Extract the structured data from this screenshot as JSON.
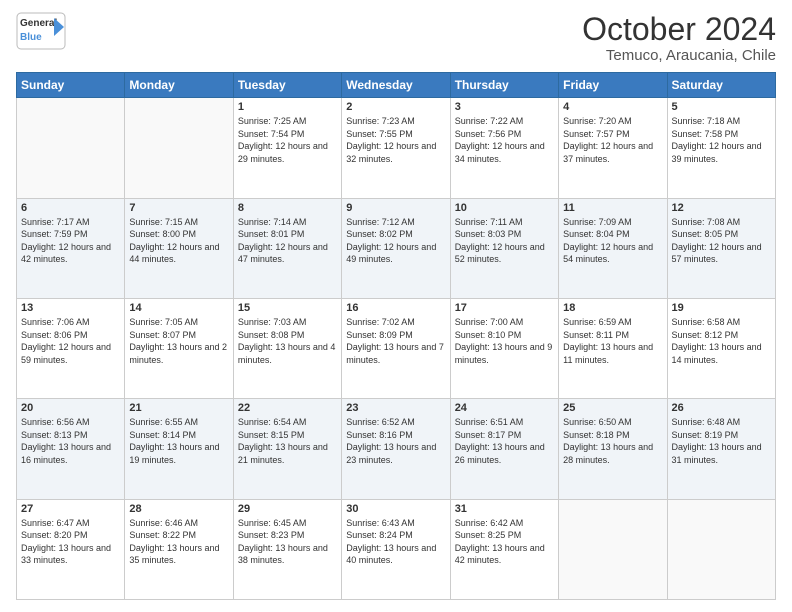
{
  "logo": {
    "line1": "General",
    "line2": "Blue"
  },
  "title": "October 2024",
  "subtitle": "Temuco, Araucania, Chile",
  "days_of_week": [
    "Sunday",
    "Monday",
    "Tuesday",
    "Wednesday",
    "Thursday",
    "Friday",
    "Saturday"
  ],
  "weeks": [
    [
      {
        "day": "",
        "sunrise": "",
        "sunset": "",
        "daylight": ""
      },
      {
        "day": "",
        "sunrise": "",
        "sunset": "",
        "daylight": ""
      },
      {
        "day": "1",
        "sunrise": "Sunrise: 7:25 AM",
        "sunset": "Sunset: 7:54 PM",
        "daylight": "Daylight: 12 hours and 29 minutes."
      },
      {
        "day": "2",
        "sunrise": "Sunrise: 7:23 AM",
        "sunset": "Sunset: 7:55 PM",
        "daylight": "Daylight: 12 hours and 32 minutes."
      },
      {
        "day": "3",
        "sunrise": "Sunrise: 7:22 AM",
        "sunset": "Sunset: 7:56 PM",
        "daylight": "Daylight: 12 hours and 34 minutes."
      },
      {
        "day": "4",
        "sunrise": "Sunrise: 7:20 AM",
        "sunset": "Sunset: 7:57 PM",
        "daylight": "Daylight: 12 hours and 37 minutes."
      },
      {
        "day": "5",
        "sunrise": "Sunrise: 7:18 AM",
        "sunset": "Sunset: 7:58 PM",
        "daylight": "Daylight: 12 hours and 39 minutes."
      }
    ],
    [
      {
        "day": "6",
        "sunrise": "Sunrise: 7:17 AM",
        "sunset": "Sunset: 7:59 PM",
        "daylight": "Daylight: 12 hours and 42 minutes."
      },
      {
        "day": "7",
        "sunrise": "Sunrise: 7:15 AM",
        "sunset": "Sunset: 8:00 PM",
        "daylight": "Daylight: 12 hours and 44 minutes."
      },
      {
        "day": "8",
        "sunrise": "Sunrise: 7:14 AM",
        "sunset": "Sunset: 8:01 PM",
        "daylight": "Daylight: 12 hours and 47 minutes."
      },
      {
        "day": "9",
        "sunrise": "Sunrise: 7:12 AM",
        "sunset": "Sunset: 8:02 PM",
        "daylight": "Daylight: 12 hours and 49 minutes."
      },
      {
        "day": "10",
        "sunrise": "Sunrise: 7:11 AM",
        "sunset": "Sunset: 8:03 PM",
        "daylight": "Daylight: 12 hours and 52 minutes."
      },
      {
        "day": "11",
        "sunrise": "Sunrise: 7:09 AM",
        "sunset": "Sunset: 8:04 PM",
        "daylight": "Daylight: 12 hours and 54 minutes."
      },
      {
        "day": "12",
        "sunrise": "Sunrise: 7:08 AM",
        "sunset": "Sunset: 8:05 PM",
        "daylight": "Daylight: 12 hours and 57 minutes."
      }
    ],
    [
      {
        "day": "13",
        "sunrise": "Sunrise: 7:06 AM",
        "sunset": "Sunset: 8:06 PM",
        "daylight": "Daylight: 12 hours and 59 minutes."
      },
      {
        "day": "14",
        "sunrise": "Sunrise: 7:05 AM",
        "sunset": "Sunset: 8:07 PM",
        "daylight": "Daylight: 13 hours and 2 minutes."
      },
      {
        "day": "15",
        "sunrise": "Sunrise: 7:03 AM",
        "sunset": "Sunset: 8:08 PM",
        "daylight": "Daylight: 13 hours and 4 minutes."
      },
      {
        "day": "16",
        "sunrise": "Sunrise: 7:02 AM",
        "sunset": "Sunset: 8:09 PM",
        "daylight": "Daylight: 13 hours and 7 minutes."
      },
      {
        "day": "17",
        "sunrise": "Sunrise: 7:00 AM",
        "sunset": "Sunset: 8:10 PM",
        "daylight": "Daylight: 13 hours and 9 minutes."
      },
      {
        "day": "18",
        "sunrise": "Sunrise: 6:59 AM",
        "sunset": "Sunset: 8:11 PM",
        "daylight": "Daylight: 13 hours and 11 minutes."
      },
      {
        "day": "19",
        "sunrise": "Sunrise: 6:58 AM",
        "sunset": "Sunset: 8:12 PM",
        "daylight": "Daylight: 13 hours and 14 minutes."
      }
    ],
    [
      {
        "day": "20",
        "sunrise": "Sunrise: 6:56 AM",
        "sunset": "Sunset: 8:13 PM",
        "daylight": "Daylight: 13 hours and 16 minutes."
      },
      {
        "day": "21",
        "sunrise": "Sunrise: 6:55 AM",
        "sunset": "Sunset: 8:14 PM",
        "daylight": "Daylight: 13 hours and 19 minutes."
      },
      {
        "day": "22",
        "sunrise": "Sunrise: 6:54 AM",
        "sunset": "Sunset: 8:15 PM",
        "daylight": "Daylight: 13 hours and 21 minutes."
      },
      {
        "day": "23",
        "sunrise": "Sunrise: 6:52 AM",
        "sunset": "Sunset: 8:16 PM",
        "daylight": "Daylight: 13 hours and 23 minutes."
      },
      {
        "day": "24",
        "sunrise": "Sunrise: 6:51 AM",
        "sunset": "Sunset: 8:17 PM",
        "daylight": "Daylight: 13 hours and 26 minutes."
      },
      {
        "day": "25",
        "sunrise": "Sunrise: 6:50 AM",
        "sunset": "Sunset: 8:18 PM",
        "daylight": "Daylight: 13 hours and 28 minutes."
      },
      {
        "day": "26",
        "sunrise": "Sunrise: 6:48 AM",
        "sunset": "Sunset: 8:19 PM",
        "daylight": "Daylight: 13 hours and 31 minutes."
      }
    ],
    [
      {
        "day": "27",
        "sunrise": "Sunrise: 6:47 AM",
        "sunset": "Sunset: 8:20 PM",
        "daylight": "Daylight: 13 hours and 33 minutes."
      },
      {
        "day": "28",
        "sunrise": "Sunrise: 6:46 AM",
        "sunset": "Sunset: 8:22 PM",
        "daylight": "Daylight: 13 hours and 35 minutes."
      },
      {
        "day": "29",
        "sunrise": "Sunrise: 6:45 AM",
        "sunset": "Sunset: 8:23 PM",
        "daylight": "Daylight: 13 hours and 38 minutes."
      },
      {
        "day": "30",
        "sunrise": "Sunrise: 6:43 AM",
        "sunset": "Sunset: 8:24 PM",
        "daylight": "Daylight: 13 hours and 40 minutes."
      },
      {
        "day": "31",
        "sunrise": "Sunrise: 6:42 AM",
        "sunset": "Sunset: 8:25 PM",
        "daylight": "Daylight: 13 hours and 42 minutes."
      },
      {
        "day": "",
        "sunrise": "",
        "sunset": "",
        "daylight": ""
      },
      {
        "day": "",
        "sunrise": "",
        "sunset": "",
        "daylight": ""
      }
    ]
  ]
}
